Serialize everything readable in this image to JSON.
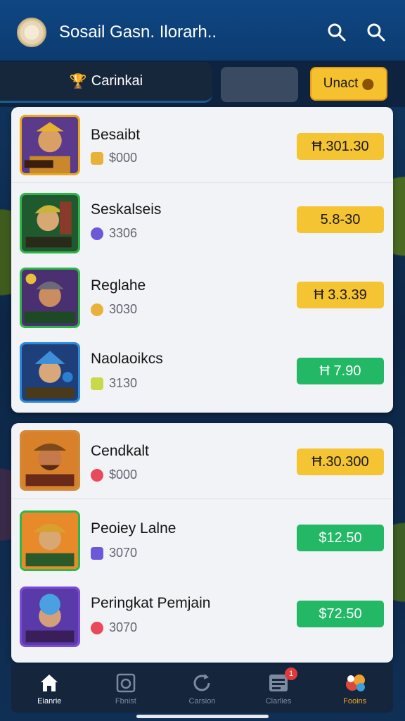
{
  "header": {
    "title": "Sosail Gasn. Ilorarh..",
    "icons": [
      "search-icon",
      "search-icon"
    ]
  },
  "tabs": {
    "main_label": "Carinkai",
    "action_label": "Unact"
  },
  "list_1": [
    {
      "name": "Besaibt",
      "sub": "$000",
      "price": "Ħ.301.30",
      "price_color": "yellow",
      "frame": "gold",
      "badge": "#e8b23a"
    },
    {
      "name": "Seskalseis",
      "sub": "3306",
      "price": "5.8-30",
      "price_color": "yellow",
      "frame": "green",
      "badge": "#6a5ad8"
    },
    {
      "name": "Reglahe",
      "sub": "3030",
      "price": "Ħ 3.3.39",
      "price_color": "yellow",
      "frame": "green",
      "badge": "#e8b23a"
    },
    {
      "name": "Naolaoikcs",
      "sub": "3130",
      "price": "Ħ 7.90",
      "price_color": "green",
      "frame": "blue",
      "badge": "#c9d94a"
    }
  ],
  "list_2": [
    {
      "name": "Cendkalt",
      "sub": "$000",
      "price": "Ħ.30.300",
      "price_color": "yellow",
      "frame": "gold",
      "badge": "#e84a5a"
    },
    {
      "name": "Peoiey Lalne",
      "sub": "3070",
      "price": "$12.50",
      "price_color": "green",
      "frame": "green",
      "badge": "#6a5ad8"
    },
    {
      "name": "Peringkat Pemjain",
      "sub": "3070",
      "price": "$72.50",
      "price_color": "green",
      "frame": "purple",
      "badge": "#e84a5a"
    }
  ],
  "nav": [
    {
      "label": "Eianrie",
      "icon": "home-icon"
    },
    {
      "label": "Fbnist",
      "icon": "camera-icon"
    },
    {
      "label": "Carsion",
      "icon": "refresh-icon"
    },
    {
      "label": "Clarlies",
      "icon": "list-icon",
      "badge": "1"
    },
    {
      "label": "Fooins",
      "icon": "prizes-icon"
    }
  ],
  "colors": {
    "header": "#0f4784",
    "accent_yellow": "#f5c433",
    "accent_green": "#22b866"
  }
}
